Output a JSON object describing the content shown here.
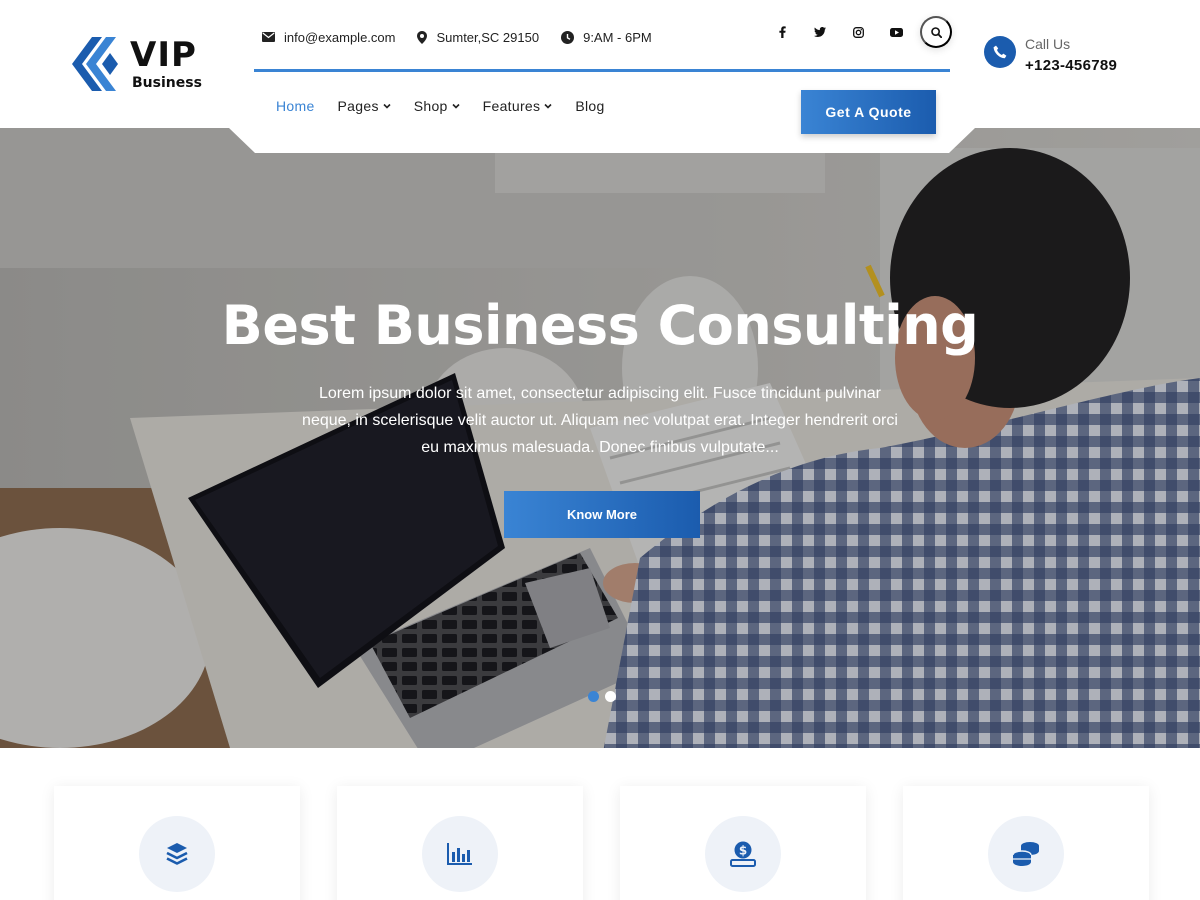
{
  "brand": {
    "name": "VIP",
    "tagline": "Business"
  },
  "topbar": {
    "email": "info@example.com",
    "address": "Sumter,SC 29150",
    "hours": "9:AM - 6PM",
    "socials": [
      "facebook-icon",
      "twitter-icon",
      "instagram-icon",
      "youtube-icon"
    ]
  },
  "nav": {
    "items": [
      {
        "label": "Home",
        "active": true,
        "dropdown": false
      },
      {
        "label": "Pages",
        "active": false,
        "dropdown": true
      },
      {
        "label": "Shop",
        "active": false,
        "dropdown": true
      },
      {
        "label": "Features",
        "active": false,
        "dropdown": true
      },
      {
        "label": "Blog",
        "active": false,
        "dropdown": false
      }
    ],
    "cta": "Get A Quote"
  },
  "call": {
    "label": "Call Us",
    "number": "+123-456789"
  },
  "hero": {
    "title": "Best Business Consulting",
    "description": "Lorem ipsum dolor sit amet, consectetur adipiscing elit. Fusce tincidunt pulvinar neque, in scelerisque velit auctor ut. Aliquam nec volutpat erat. Integer hendrerit orci eu maximus malesuada. Donec finibus vulputate...",
    "button": "Know More",
    "slides": 2,
    "active_slide": 1
  },
  "services": {
    "icons": [
      "layers-icon",
      "bar-chart-icon",
      "money-hand-icon",
      "coins-icon"
    ]
  },
  "colors": {
    "accent": "#3a84d4",
    "accent_dark": "#1b5cae",
    "text": "#222222"
  }
}
